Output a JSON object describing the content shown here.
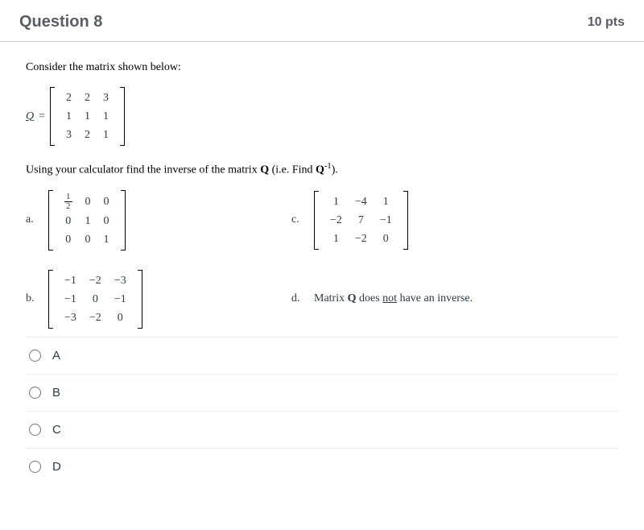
{
  "header": {
    "title": "Question 8",
    "points": "10 pts"
  },
  "prompt": {
    "intro": "Consider the matrix shown below:",
    "q_symbol": "Q",
    "equals": " = ",
    "matrix_Q": [
      [
        "2",
        "2",
        "3"
      ],
      [
        "1",
        "1",
        "1"
      ],
      [
        "3",
        "2",
        "1"
      ]
    ],
    "instruction_pre": "Using your calculator find the inverse of the matrix ",
    "instruction_bold": "Q",
    "instruction_mid": " (i.e. Find ",
    "instruction_q": "Q",
    "instruction_sup": "-1",
    "instruction_end": ")."
  },
  "options": {
    "a": {
      "label": "a.",
      "matrix": [
        [
          "½",
          "0",
          "0"
        ],
        [
          "0",
          "1",
          "0"
        ],
        [
          "0",
          "0",
          "1"
        ]
      ]
    },
    "b": {
      "label": "b.",
      "matrix": [
        [
          "−1",
          "−2",
          "−3"
        ],
        [
          "−1",
          "0",
          "−1"
        ],
        [
          "−3",
          "−2",
          "0"
        ]
      ]
    },
    "c": {
      "label": "c.",
      "matrix": [
        [
          "1",
          "−4",
          "1"
        ],
        [
          "−2",
          "7",
          "−1"
        ],
        [
          "1",
          "−2",
          "0"
        ]
      ]
    },
    "d": {
      "label": "d.",
      "text_pre": "Matrix ",
      "text_bold": "Q",
      "text_mid": " does ",
      "text_underline": "not",
      "text_end": " have an inverse."
    }
  },
  "answers": [
    {
      "value": "A",
      "label": "A"
    },
    {
      "value": "B",
      "label": "B"
    },
    {
      "value": "C",
      "label": "C"
    },
    {
      "value": "D",
      "label": "D"
    }
  ]
}
